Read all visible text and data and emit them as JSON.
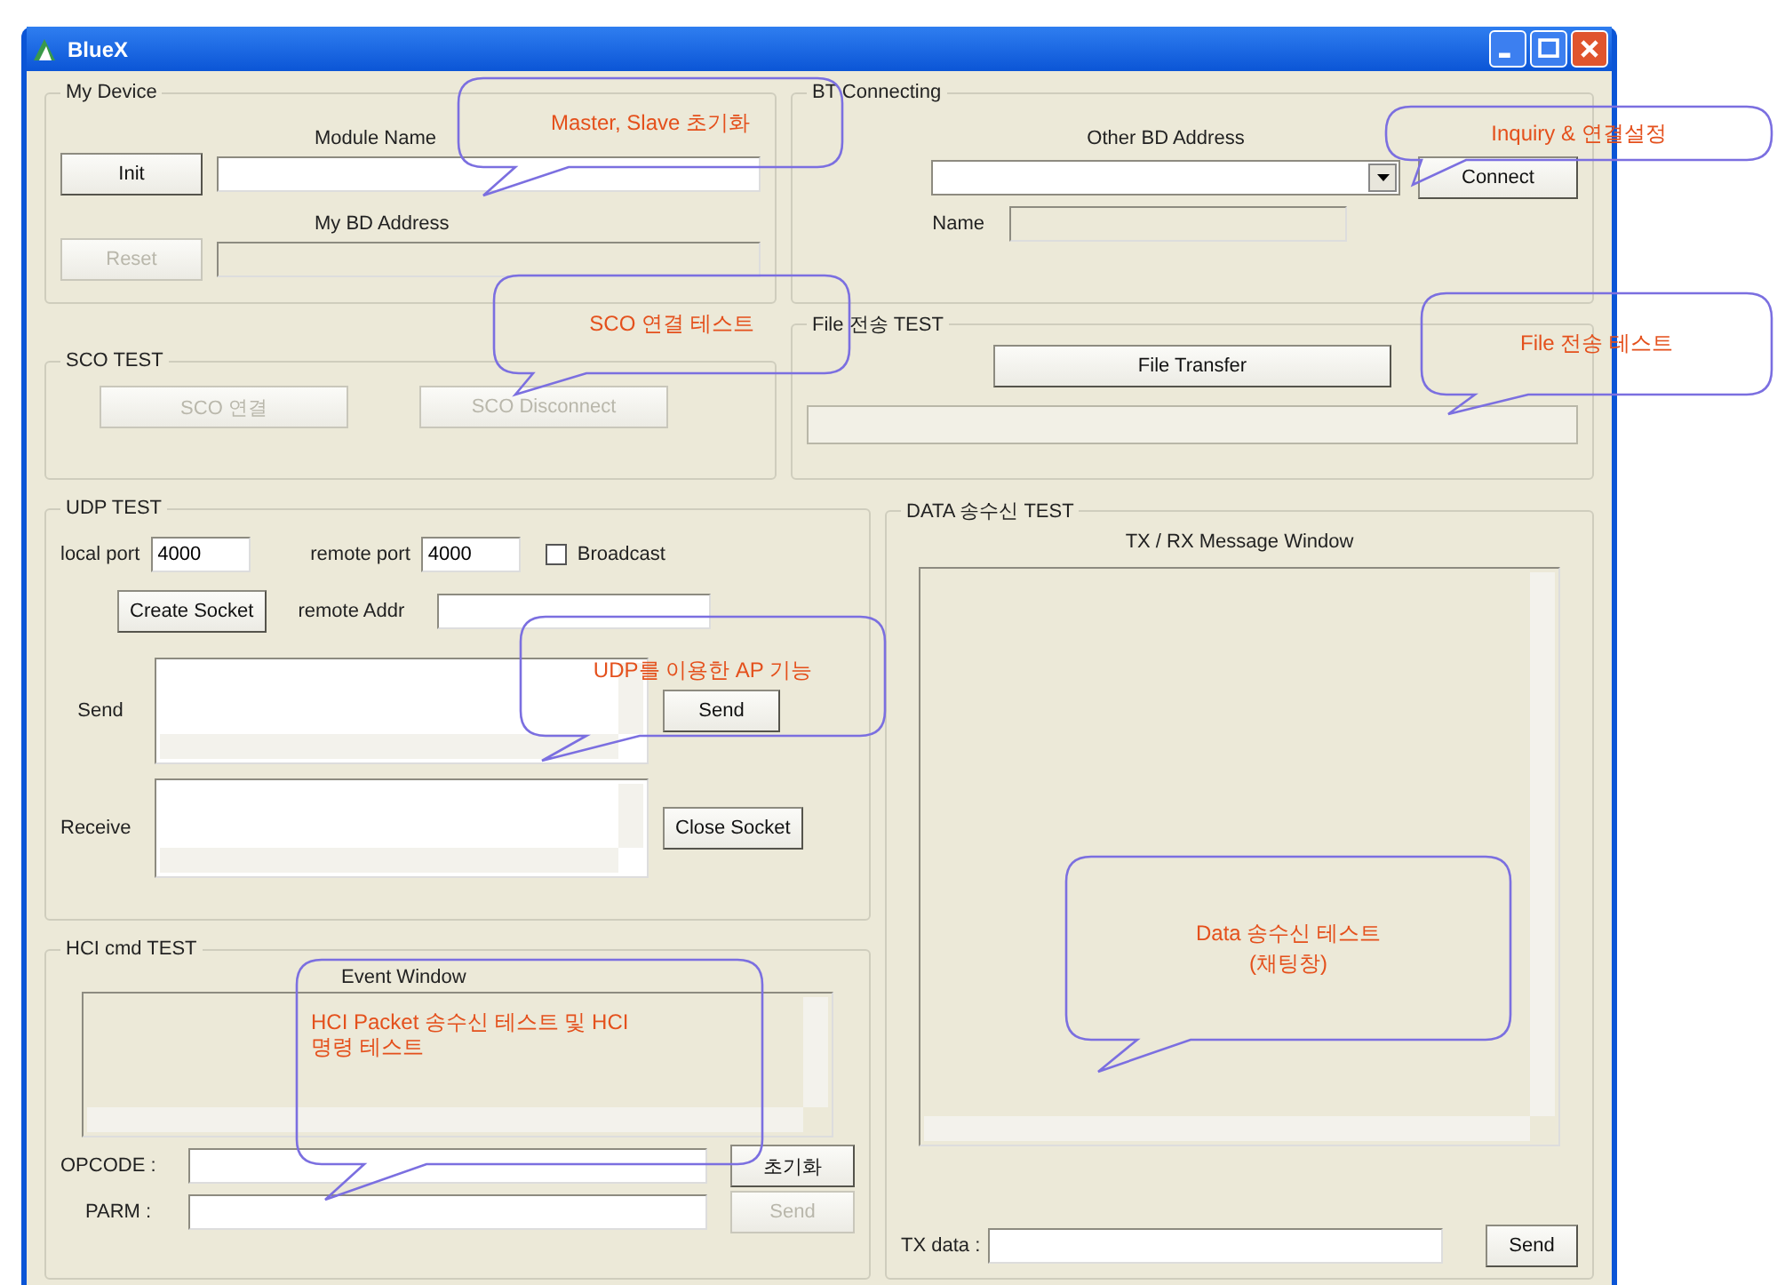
{
  "window": {
    "title": "BlueX"
  },
  "my_device": {
    "title": "My Device",
    "module_label": "Module Name",
    "init_button": {
      "label": "Init",
      "disabled": false
    },
    "module_field": {
      "disabled": false
    },
    "address_label": "My BD Address",
    "reset_button": {
      "label": "Reset",
      "disabled": true
    },
    "address_field": {
      "disabled": true
    }
  },
  "bt_connecting": {
    "title": "BT Connecting",
    "other_label": "Other BD Address",
    "connect_button": {
      "label": "Connect",
      "disabled": false
    },
    "name_label": "Name",
    "name_field": {
      "disabled": true
    }
  },
  "sco_test": {
    "title": "SCO TEST",
    "buttons": [
      {
        "label": "SCO 연결",
        "disabled": true
      },
      {
        "label": "SCO Disconnect",
        "disabled": true
      }
    ]
  },
  "file_test": {
    "title": "File 전송 TEST",
    "transfer_button": {
      "label": "File Transfer",
      "disabled": false
    },
    "progress": {
      "level": 0
    }
  },
  "udp_test": {
    "title": "UDP TEST",
    "local_port_label": "local port",
    "local_port": "4000",
    "remote_port_label": "remote port",
    "remote_port": "4000",
    "broadcast": {
      "label": "Broadcast",
      "checked": false
    },
    "create_button": {
      "label": "Create Socket",
      "disabled": false
    },
    "remote_addr_label": "remote Addr",
    "send_label": "Send",
    "send_button": {
      "label": "Send",
      "disabled": false
    },
    "receive_label": "Receive",
    "close_button": {
      "label": "Close Socket",
      "disabled": false
    }
  },
  "hci_test": {
    "title": "HCI cmd TEST",
    "event_label": "Event Window",
    "opcode_label": "OPCODE :",
    "reset_button": {
      "label": "초기화",
      "disabled": false
    },
    "parm_label": "PARM :",
    "send_button": {
      "label": "Send",
      "disabled": true
    }
  },
  "data_test": {
    "title": "DATA 송수신 TEST",
    "window_label": "TX / RX Message Window",
    "tx_label": "TX data :",
    "send_button": {
      "label": "Send",
      "disabled": false
    }
  },
  "callouts": [
    {
      "lines": [
        "Master, Slave 초기화"
      ]
    },
    {
      "lines": [
        "Inquiry & 연결설정"
      ]
    },
    {
      "lines": [
        "SCO 연결 테스트"
      ]
    },
    {
      "lines": [
        "File 전송 테스트"
      ]
    },
    {
      "lines": [
        "UDP를 이용한 AP 기능"
      ]
    },
    {
      "lines": [
        "HCI Packet 송수신 테스트 및 HCI",
        "명령 테스트"
      ]
    },
    {
      "lines": [
        "Data 송수신 테스트",
        "(채팅창)"
      ]
    }
  ]
}
